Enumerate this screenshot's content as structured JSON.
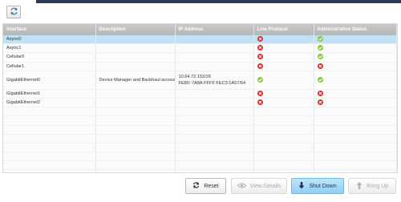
{
  "toolbar": {
    "refresh_icon": "refresh-icon"
  },
  "table": {
    "columns": [
      "Interface",
      "Description",
      "IP Address",
      "Line Protocol",
      "Administrative Status"
    ],
    "rows": [
      {
        "interface": "Async0",
        "description": "",
        "ip": [
          "",
          ""
        ],
        "line": "down",
        "admin": "up"
      },
      {
        "interface": "Async1",
        "description": "",
        "ip": [
          "",
          ""
        ],
        "line": "down",
        "admin": "up"
      },
      {
        "interface": "Cellular0",
        "description": "",
        "ip": [
          "",
          ""
        ],
        "line": "down",
        "admin": "up"
      },
      {
        "interface": "Cellular1",
        "description": "",
        "ip": [
          "",
          ""
        ],
        "line": "down",
        "admin": "down"
      },
      {
        "interface": "GigabitEthernet0",
        "description": "Device Manager and Backhaul access",
        "ip": [
          "10.64.72.152/26",
          "FE80::7A8A:FFFF:FEC3:1A57/64"
        ],
        "line": "up",
        "admin": "up"
      },
      {
        "interface": "GigabitEthernet1",
        "description": "",
        "ip": [
          "",
          ""
        ],
        "line": "down",
        "admin": "down"
      },
      {
        "interface": "GigabitEthernet2",
        "description": "",
        "ip": [
          "",
          ""
        ],
        "line": "down",
        "admin": "down"
      }
    ],
    "empty_rows": 9
  },
  "buttons": {
    "reset": "Reset",
    "view_details": "View Details",
    "shut_down": "Shut Down",
    "bring_up": "Bring Up"
  },
  "colors": {
    "status_up": "#8cc63f",
    "status_down": "#d92e2e",
    "selected_row": "#bfe0f5"
  }
}
